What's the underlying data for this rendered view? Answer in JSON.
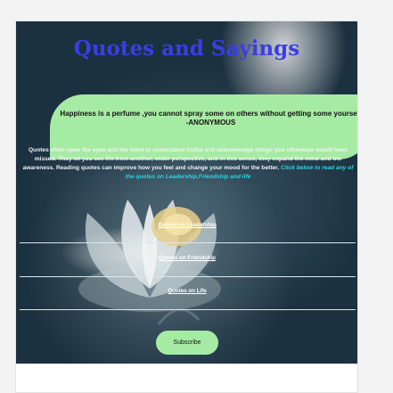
{
  "page": {
    "title": "Quotes and Sayings"
  },
  "quote": {
    "text": "Happiness is a perfume ,you cannot spray some on others without getting some yourself",
    "author": "-ANONYMOUS"
  },
  "intro": {
    "text": "Quotes often open the eyes and the mind to understand truths and acknowledge things you otherwise would have missed. They let you see life from another, wider perspective, and in this sense, they expand the mind and the awareness. Reading quotes can improve how you feel and change your mood for the better.",
    "cta": "Click below to read any of the quotes on Leadership,Friendship and life"
  },
  "links": [
    {
      "label": "Quotes on Leadership"
    },
    {
      "label": "Quotes on Friendship"
    },
    {
      "label": "Quotes on Life"
    }
  ],
  "subscribe": {
    "label": "Subscribe"
  },
  "colors": {
    "title": "#3b3ee6",
    "accent_green": "#a6eba3",
    "cta_cyan": "#2ad7e0",
    "hero_dark": "#1c3140"
  }
}
